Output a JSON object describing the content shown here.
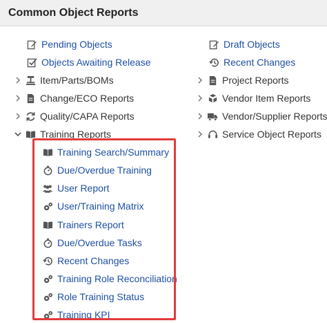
{
  "header": {
    "title": "Common Object Reports"
  },
  "left_column": [
    {
      "type": "link",
      "label": "Pending Objects",
      "icon": "edit-document-icon"
    },
    {
      "type": "link",
      "label": "Objects Awaiting Release",
      "icon": "checkmark-document-icon"
    },
    {
      "type": "folder",
      "label": "Item/Parts/BOMs",
      "icon": "parts-icon",
      "expanded": false
    },
    {
      "type": "folder",
      "label": "Change/ECO Reports",
      "icon": "document-icon",
      "expanded": false
    },
    {
      "type": "folder",
      "label": "Quality/CAPA Reports",
      "icon": "refresh-icon",
      "expanded": false
    },
    {
      "type": "folder",
      "label": "Training Reports",
      "icon": "book-icon",
      "expanded": true
    }
  ],
  "training_children": [
    {
      "label": "Training Search/Summary",
      "icon": "book-icon"
    },
    {
      "label": "Due/Overdue Training",
      "icon": "stopwatch-icon"
    },
    {
      "label": "User Report",
      "icon": "users-icon"
    },
    {
      "label": "User/Training Matrix",
      "icon": "gears-icon"
    },
    {
      "label": "Trainers Report",
      "icon": "book-icon"
    },
    {
      "label": "Due/Overdue Tasks",
      "icon": "stopwatch-icon"
    },
    {
      "label": "Recent Changes",
      "icon": "history-icon"
    },
    {
      "label": "Training Role Reconciliation",
      "icon": "gears-icon"
    },
    {
      "label": "Role Training Status",
      "icon": "gears-icon"
    },
    {
      "label": "Training KPI",
      "icon": "gears-icon"
    }
  ],
  "right_column": [
    {
      "type": "link",
      "label": "Draft Objects",
      "icon": "edit-document-icon"
    },
    {
      "type": "link",
      "label": "Recent Changes",
      "icon": "history-icon"
    },
    {
      "type": "folder",
      "label": "Project Reports",
      "icon": "document-icon",
      "expanded": false
    },
    {
      "type": "folder",
      "label": "Vendor Item Reports",
      "icon": "cubes-icon",
      "expanded": false
    },
    {
      "type": "folder",
      "label": "Vendor/Supplier Reports",
      "icon": "truck-icon",
      "expanded": false
    },
    {
      "type": "folder",
      "label": "Service Object Reports",
      "icon": "headset-icon",
      "expanded": false
    }
  ],
  "colors": {
    "link": "#1f4fa3",
    "highlight": "#e23b3b",
    "icon": "#555555"
  }
}
